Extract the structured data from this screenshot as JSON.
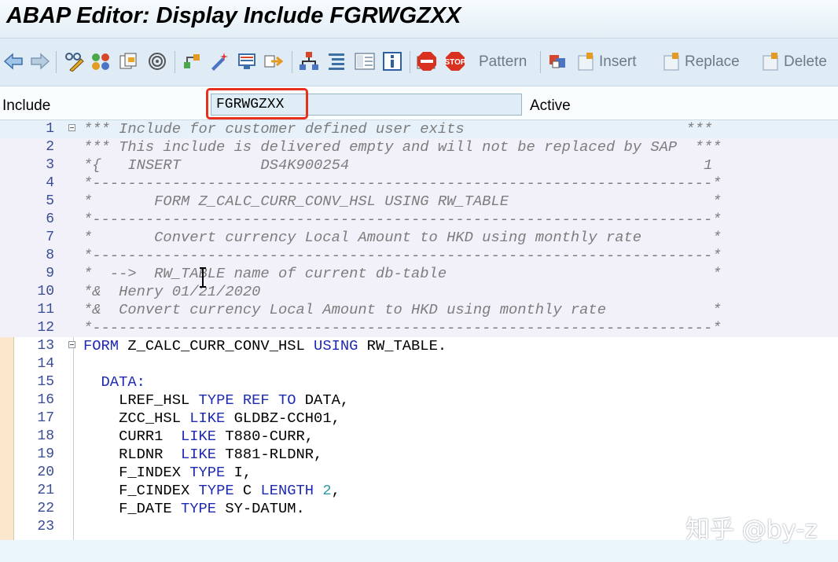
{
  "window": {
    "title": "ABAP Editor: Display Include FGRWGZXX"
  },
  "toolbar": {
    "pattern_label": "Pattern",
    "insert_label": "Insert",
    "replace_label": "Replace",
    "delete_label": "Delete"
  },
  "include_bar": {
    "label": "Include",
    "value": "FGRWGZXX",
    "status": "Active"
  },
  "editor": {
    "lines": [
      {
        "n": "1",
        "type": "comment",
        "text": "*** Include for customer defined user exits                         ***"
      },
      {
        "n": "2",
        "type": "comment",
        "text": "*** This include is delivered empty and will not be replaced by SAP  ***"
      },
      {
        "n": "3",
        "type": "comment",
        "text": "*{   INSERT         DS4K900254                                        1"
      },
      {
        "n": "4",
        "type": "comment",
        "text": "*----------------------------------------------------------------------*"
      },
      {
        "n": "5",
        "type": "comment",
        "text": "*       FORM Z_CALC_CURR_CONV_HSL USING RW_TABLE                       *"
      },
      {
        "n": "6",
        "type": "comment",
        "text": "*----------------------------------------------------------------------*"
      },
      {
        "n": "7",
        "type": "comment",
        "text": "*       Convert currency Local Amount to HKD using monthly rate        *"
      },
      {
        "n": "8",
        "type": "comment",
        "text": "*----------------------------------------------------------------------*"
      },
      {
        "n": "9",
        "type": "comment",
        "text": "*  -->  RW_TABLE name of current db-table                              *"
      },
      {
        "n": "10",
        "type": "comment",
        "text": "*&  Henry 01/21/2020"
      },
      {
        "n": "11",
        "type": "comment",
        "text": "*&  Convert currency Local Amount to HKD using monthly rate            *"
      },
      {
        "n": "12",
        "type": "comment",
        "text": "*----------------------------------------------------------------------*"
      },
      {
        "n": "13",
        "type": "code",
        "parts": [
          [
            "FORM",
            "kw"
          ],
          [
            " Z_CALC_CURR_CONV_HSL ",
            ""
          ],
          [
            "USING",
            "kw"
          ],
          [
            " RW_TABLE.",
            ""
          ]
        ]
      },
      {
        "n": "14",
        "type": "code",
        "parts": []
      },
      {
        "n": "15",
        "type": "code",
        "parts": [
          [
            "  DATA:",
            "kw"
          ]
        ]
      },
      {
        "n": "16",
        "type": "code",
        "parts": [
          [
            "    LREF_HSL ",
            ""
          ],
          [
            "TYPE REF TO",
            "kw"
          ],
          [
            " DATA,",
            ""
          ]
        ]
      },
      {
        "n": "17",
        "type": "code",
        "parts": [
          [
            "    ZCC_HSL ",
            ""
          ],
          [
            "LIKE",
            "kw"
          ],
          [
            " GLDBZ-CCH01,",
            ""
          ]
        ]
      },
      {
        "n": "18",
        "type": "code",
        "parts": [
          [
            "    CURR1  ",
            ""
          ],
          [
            "LIKE",
            "kw"
          ],
          [
            " T880-CURR,",
            ""
          ]
        ]
      },
      {
        "n": "19",
        "type": "code",
        "parts": [
          [
            "    RLDNR  ",
            ""
          ],
          [
            "LIKE",
            "kw"
          ],
          [
            " T881-RLDNR,",
            ""
          ]
        ]
      },
      {
        "n": "20",
        "type": "code",
        "parts": [
          [
            "    F_INDEX ",
            ""
          ],
          [
            "TYPE",
            "kw"
          ],
          [
            " I,",
            ""
          ]
        ]
      },
      {
        "n": "21",
        "type": "code",
        "parts": [
          [
            "    F_CINDEX ",
            ""
          ],
          [
            "TYPE",
            "kw"
          ],
          [
            " C ",
            ""
          ],
          [
            "LENGTH",
            "kw"
          ],
          [
            " ",
            ""
          ],
          [
            "2",
            "num"
          ],
          [
            ",",
            ""
          ]
        ]
      },
      {
        "n": "22",
        "type": "code",
        "parts": [
          [
            "    F_DATE ",
            ""
          ],
          [
            "TYPE",
            "kw"
          ],
          [
            " SY-DATUM.",
            ""
          ]
        ]
      },
      {
        "n": "23",
        "type": "code",
        "parts": []
      }
    ]
  },
  "watermark": {
    "text": "知乎 @by-z"
  },
  "icons": [
    "back-arrow-icon",
    "forward-arrow-icon",
    "display-change-icon",
    "activate-icon",
    "other-object-icon",
    "where-used-icon",
    "hierarchy-icon",
    "magic-wand-icon",
    "display-object-list-icon",
    "navigation-icon",
    "tree-icon",
    "pretty-printer-icon",
    "layout-icon",
    "info-icon",
    "stop-icon",
    "help-icon",
    "enhance-icon"
  ]
}
